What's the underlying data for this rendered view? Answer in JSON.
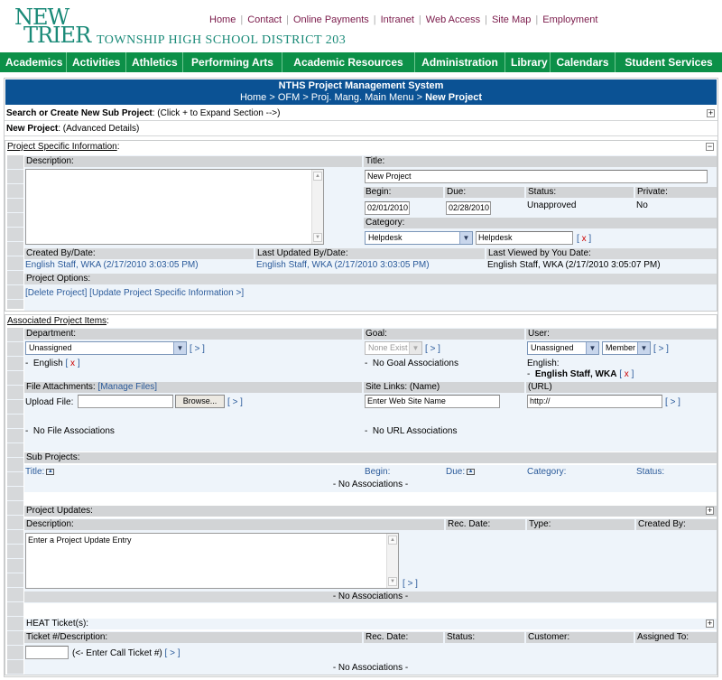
{
  "header": {
    "logo_line1": "NEW",
    "logo_line2": "TRIER",
    "logo_line3": "TOWNSHIP HIGH SCHOOL DISTRICT 203",
    "links": [
      "Home",
      "Contact",
      "Online Payments",
      "Intranet",
      "Web Access",
      "Site Map",
      "Employment"
    ]
  },
  "nav": [
    "Academics",
    "Activities",
    "Athletics",
    "Performing Arts",
    "Academic Resources",
    "Administration",
    "Library",
    "Calendars",
    "Student Services"
  ],
  "titlebar": {
    "title": "NTHS Project Management System",
    "crumbs": "Home > OFM > Proj. Mang. Main Menu > ",
    "current": "New Project"
  },
  "search_section": {
    "label": "Search or Create New Sub Project",
    "hint": ": (Click + to Expand Section -->)",
    "toggle": "+"
  },
  "new_project": {
    "label": "New Project",
    "hint": ": (Advanced Details)"
  },
  "psi": {
    "heading": "Project Specific Information",
    "colon": ":",
    "toggle": "−",
    "description_label": "Description:",
    "title_label": "Title:",
    "title_value": "New Project",
    "begin_label": "Begin:",
    "begin_value": "02/01/2010",
    "due_label": "Due:",
    "due_value": "02/28/2010",
    "status_label": "Status:",
    "status_value": "Unapproved",
    "private_label": "Private:",
    "private_value": "No",
    "category_label": "Category:",
    "category_select": "Helpdesk",
    "category_text": "Helpdesk",
    "remove": "x",
    "created_label": "Created By/Date:",
    "created_value": "English Staff, WKA (2/17/2010 3:03:05 PM)",
    "updated_label": "Last Updated By/Date:",
    "updated_value": "English Staff, WKA (2/17/2010 3:03:05 PM)",
    "viewed_label": "Last Viewed by You Date:",
    "viewed_value": "English Staff, WKA (2/17/2010 3:05:07 PM)",
    "options_label": "Project Options:",
    "delete_link": "Delete Project",
    "update_link": "Update Project Specific Information >"
  },
  "api": {
    "heading": "Associated Project Items",
    "colon": ":",
    "department_label": "Department:",
    "department_select": "Unassigned",
    "department_item": "English",
    "goal_label": "Goal:",
    "goal_select": "None Exist",
    "goal_none": "No Goal Associations",
    "user_label": "User:",
    "user_select": "Unassigned",
    "role_select": "Member",
    "user_group": "English:",
    "user_item": "English Staff, WKA",
    "go": ">",
    "attach_label": "File Attachments: ",
    "manage_files": "Manage Files",
    "upload_label": "Upload File:",
    "browse": "Browse...",
    "site_label": "Site Links: (Name)",
    "url_label": "(URL)",
    "site_placeholder": "Enter Web Site Name",
    "url_placeholder": "http://",
    "no_files": "No File Associations",
    "no_urls": "No URL Associations"
  },
  "sub_projects": {
    "heading": "Sub Projects:",
    "cols": [
      "Title:",
      "Begin:",
      "Due:",
      "Category:",
      "Status:"
    ],
    "none": "- No Associations -"
  },
  "updates": {
    "heading": "Project Updates:",
    "toggle": "+",
    "cols": [
      "Description:",
      "Rec. Date:",
      "Type:",
      "Created By:"
    ],
    "placeholder": "Enter a Project Update Entry",
    "none": "- No Associations -"
  },
  "heat": {
    "heading": "HEAT Ticket(s):",
    "toggle": "+",
    "cols": [
      "Ticket #/Description:",
      "Rec. Date:",
      "Status:",
      "Customer:",
      "Assigned To:"
    ],
    "enter_hint": "(<- Enter Call Ticket #)",
    "none": "- No Associations -"
  },
  "colors": {
    "nav_green": "#0c9048",
    "title_blue": "#0b5294",
    "link_blue": "#2a5a9a",
    "logo_teal": "#1a8a78"
  }
}
